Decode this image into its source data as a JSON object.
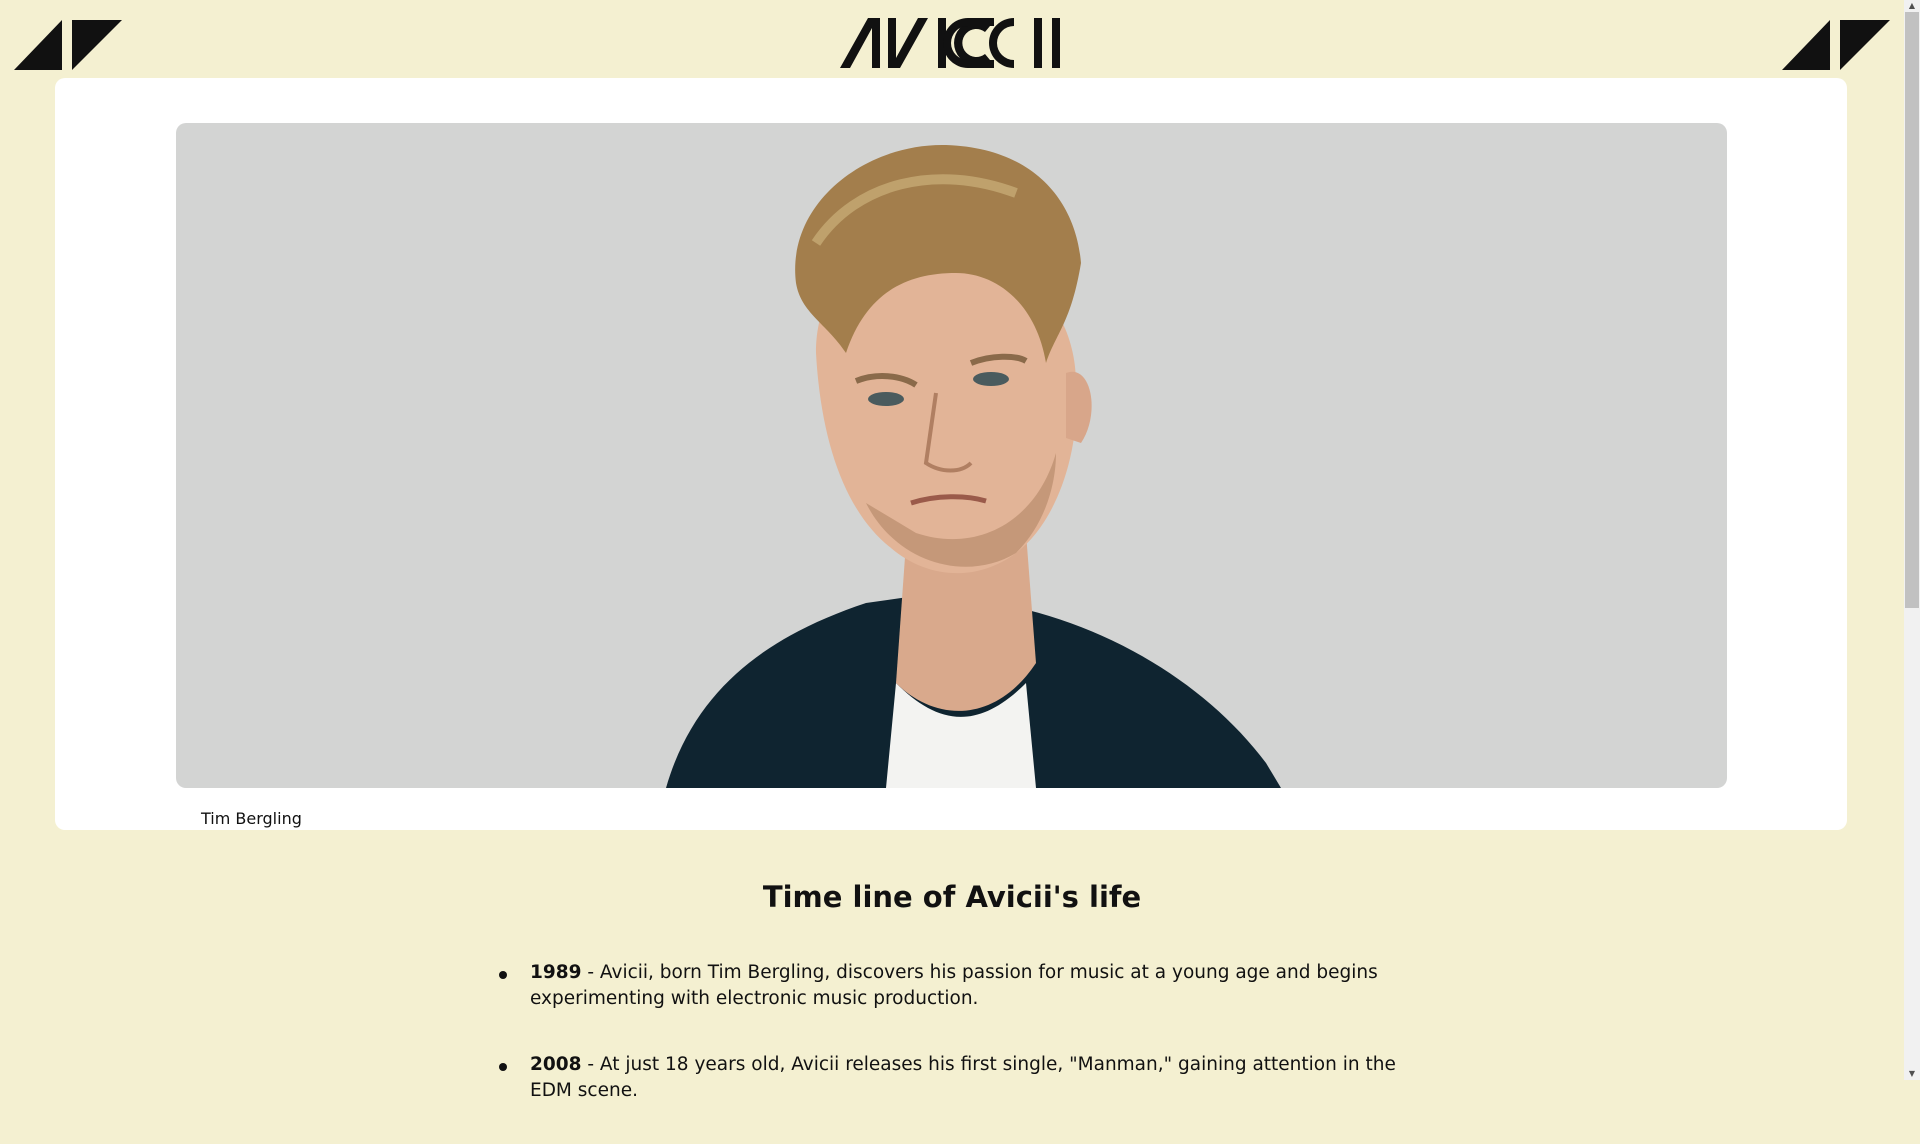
{
  "header": {
    "brand_wordmark": "AVICII",
    "left_logo_icon": "avicii-triangle-logo-icon",
    "right_logo_icon": "avicii-triangle-logo-icon"
  },
  "hero": {
    "image_subject_icon": "portrait-photo",
    "caption": "Tim Bergling"
  },
  "timeline": {
    "title": "Time line of Avicii's life",
    "items": [
      {
        "year": "1989",
        "text": " - Avicii, born Tim Bergling, discovers his passion for music at a young age and begins experimenting with electronic music production."
      },
      {
        "year": "2008",
        "text": " - At just 18 years old, Avicii releases his first single, \"Manman,\" gaining attention in the EDM scene."
      }
    ]
  },
  "colors": {
    "page_background": "#f4f0d1",
    "card_background": "#ffffff",
    "photo_background": "#d3d4d3",
    "text": "#111111"
  }
}
